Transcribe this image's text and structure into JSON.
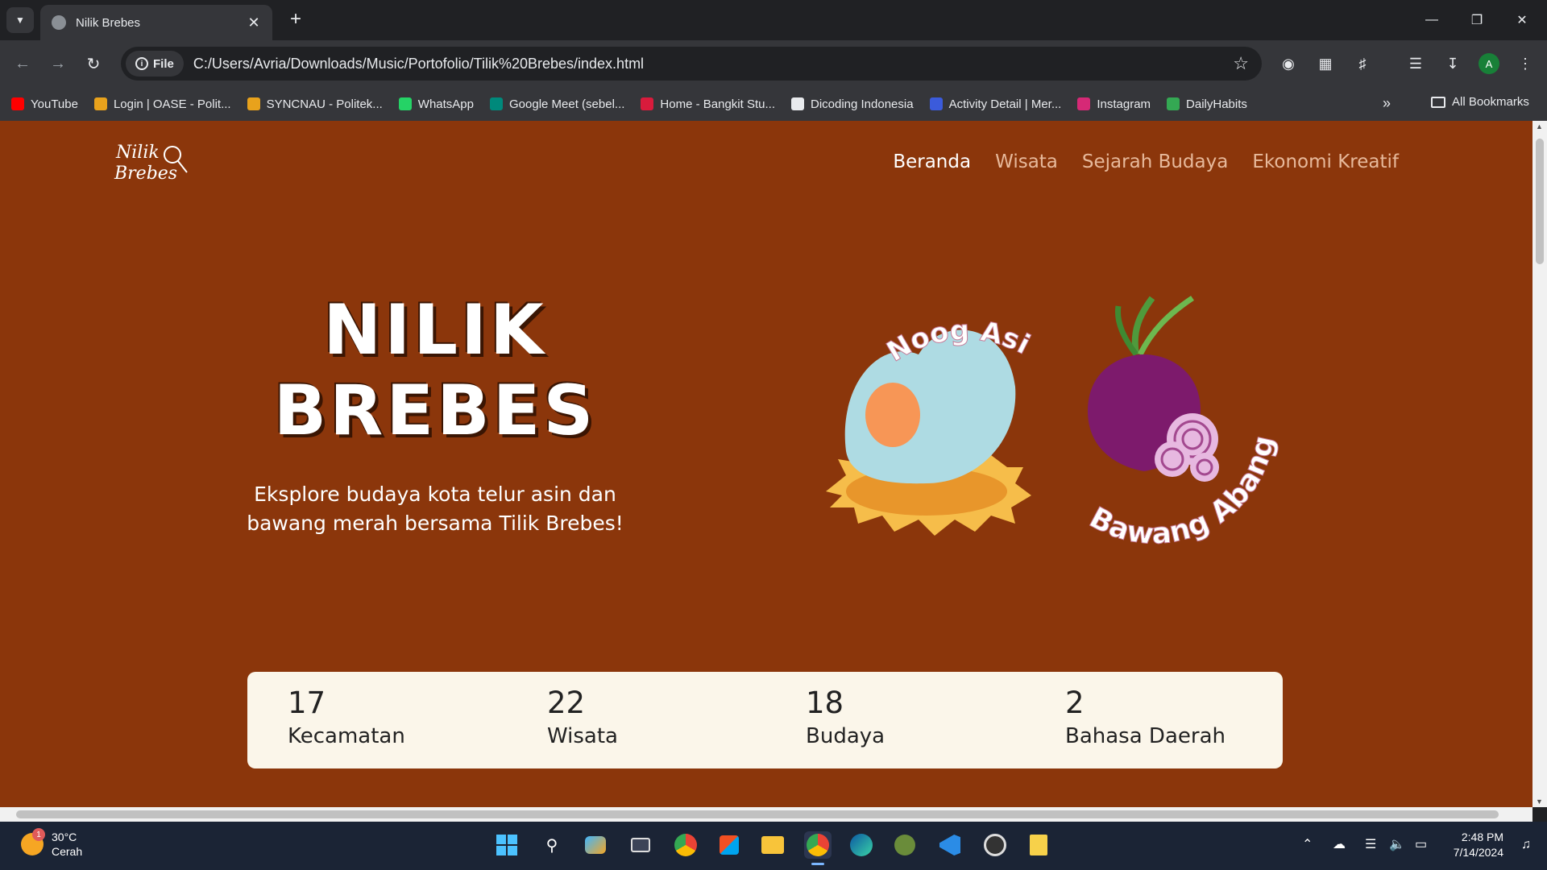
{
  "browser": {
    "tab_title": "Nilik Brebes",
    "new_tab": "+",
    "url_chip": "File",
    "url": "C:/Users/Avria/Downloads/Music/Portofolio/Tilik%20Brebes/index.html",
    "profile_initial": "A",
    "bookmarks": [
      {
        "label": "YouTube",
        "color": "#ff0000"
      },
      {
        "label": "Login | OASE - Polit...",
        "color": "#e8a21c"
      },
      {
        "label": "SYNCNAU - Politek...",
        "color": "#e8a21c"
      },
      {
        "label": "WhatsApp",
        "color": "#25d366"
      },
      {
        "label": "Google Meet (sebel...",
        "color": "#00897b"
      },
      {
        "label": "Home - Bangkit Stu...",
        "color": "#d81b3c"
      },
      {
        "label": "Dicoding Indonesia",
        "color": "#e8eaed"
      },
      {
        "label": "Activity Detail | Mer...",
        "color": "#3b5bdb"
      },
      {
        "label": "Instagram",
        "color": "#d62976"
      },
      {
        "label": "DailyHabits",
        "color": "#34a853"
      }
    ],
    "bookmarks_overflow": "»",
    "all_bookmarks": "All Bookmarks"
  },
  "site": {
    "logo_line1": "Nilik",
    "logo_line2": "Brebes",
    "nav": [
      {
        "label": "Beranda",
        "active": true
      },
      {
        "label": "Wisata",
        "active": false
      },
      {
        "label": "Sejarah Budaya",
        "active": false
      },
      {
        "label": "Ekonomi Kreatif",
        "active": false
      }
    ],
    "hero_line1": "NILIK",
    "hero_line2": "BREBES",
    "hero_subtitle_1": "Eksplore budaya kota telur asin dan",
    "hero_subtitle_2": "bawang merah bersama Tilik Brebes!",
    "illus_egg_label": "Noog Asin",
    "illus_onion_label": "Bawang Abang",
    "stats": [
      {
        "num": "17",
        "label": "Kecamatan"
      },
      {
        "num": "22",
        "label": "Wisata"
      },
      {
        "num": "18",
        "label": "Budaya"
      },
      {
        "num": "2",
        "label": "Bahasa Daerah"
      }
    ]
  },
  "taskbar": {
    "weather_temp": "30°C",
    "weather_desc": "Cerah",
    "weather_badge": "1",
    "time": "2:48 PM",
    "date": "7/14/2024"
  },
  "colors": {
    "page_bg": "#8B360B",
    "stats_bg": "#FBF6EA",
    "nav_inactive": "#e7b99b"
  }
}
